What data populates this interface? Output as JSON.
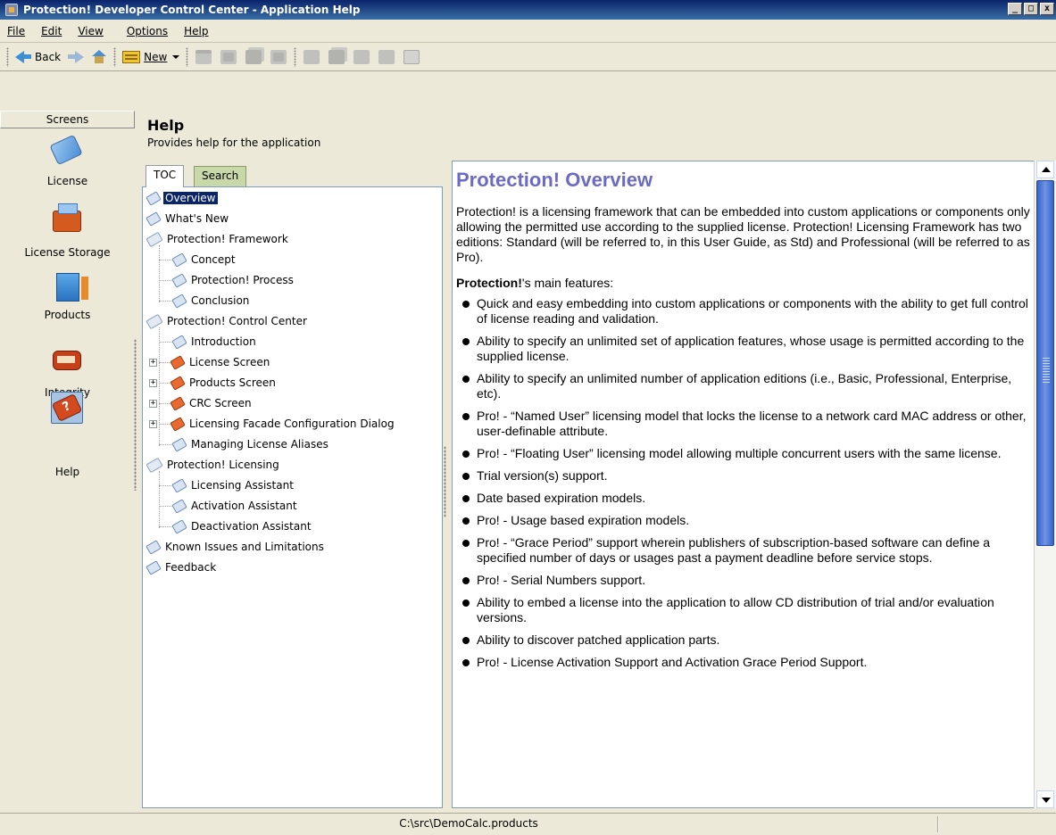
{
  "window": {
    "title": "Protection! Developer Control Center - Application Help",
    "buttons": {
      "minimize": "_",
      "maximize": "□",
      "close": "x"
    }
  },
  "menu": [
    {
      "label": "File",
      "underline": "F"
    },
    {
      "label": "Edit",
      "underline": "E"
    },
    {
      "label": "View",
      "underline": "V"
    },
    {
      "label": "Options",
      "underline": "O"
    },
    {
      "label": "Help",
      "underline": "H"
    }
  ],
  "toolbar": {
    "back_label": "Back",
    "new_label": "New",
    "icons": [
      "back-arrow-icon",
      "forward-arrow-icon",
      "home-icon",
      "new-icon",
      "open-folder-icon",
      "save-icon",
      "save-all-icon",
      "save-as-icon",
      "edit-icon",
      "copy-icon",
      "paste-icon",
      "settings-icon",
      "delete-icon"
    ]
  },
  "sidebar": {
    "header": "Screens",
    "items": [
      {
        "label": "License",
        "icon": "license-icon"
      },
      {
        "label": "License Storage",
        "icon": "license-storage-icon"
      },
      {
        "label": "Products",
        "icon": "products-icon"
      },
      {
        "label": "Integrity",
        "icon": "integrity-icon"
      },
      {
        "label": "Help",
        "icon": "help-icon",
        "selected": true
      }
    ]
  },
  "help": {
    "title": "Help",
    "subtitle": "Provides help for the application",
    "tabs": [
      {
        "label": "TOC",
        "active": true
      },
      {
        "label": "Search",
        "active": false
      }
    ]
  },
  "toc": [
    {
      "label": "Overview",
      "level": 0,
      "icon": "page",
      "selected": true
    },
    {
      "label": "What's New",
      "level": 0,
      "icon": "page"
    },
    {
      "label": "Protection! Framework",
      "level": 0,
      "icon": "book"
    },
    {
      "label": "Concept",
      "level": 1,
      "icon": "page"
    },
    {
      "label": "Protection! Process",
      "level": 1,
      "icon": "page"
    },
    {
      "label": "Conclusion",
      "level": 1,
      "icon": "page"
    },
    {
      "label": "Protection! Control Center",
      "level": 0,
      "icon": "book"
    },
    {
      "label": "Introduction",
      "level": 1,
      "icon": "page"
    },
    {
      "label": "License Screen",
      "level": 1,
      "icon": "orange",
      "expander": "+"
    },
    {
      "label": "Products Screen",
      "level": 1,
      "icon": "orange",
      "expander": "+"
    },
    {
      "label": "CRC Screen",
      "level": 1,
      "icon": "orange",
      "expander": "+"
    },
    {
      "label": "Licensing Facade Configuration Dialog",
      "level": 1,
      "icon": "orange",
      "expander": "+"
    },
    {
      "label": "Managing License Aliases",
      "level": 1,
      "icon": "page"
    },
    {
      "label": "Protection! Licensing",
      "level": 0,
      "icon": "book"
    },
    {
      "label": "Licensing Assistant",
      "level": 1,
      "icon": "page"
    },
    {
      "label": "Activation Assistant",
      "level": 1,
      "icon": "page"
    },
    {
      "label": "Deactivation Assistant",
      "level": 1,
      "icon": "page"
    },
    {
      "label": "Known Issues and Limitations",
      "level": 0,
      "icon": "page"
    },
    {
      "label": "Feedback",
      "level": 0,
      "icon": "page"
    }
  ],
  "content": {
    "heading": "Protection! Overview",
    "intro": "Protection! is a licensing framework that can be embedded into custom applications or components only allowing the permitted use according to the supplied license. Protection! Licensing Framework has two editions: Standard (will be referred to, in this User Guide, as Std) and Professional (will be referred to as Pro).",
    "features_bold": "Protection!",
    "features_rest": "'s main features:",
    "features": [
      "Quick and easy embedding into custom applications or components with the ability to get full control of license reading and validation.",
      "Ability to specify an unlimited set of application features, whose usage is permitted according to the supplied license.",
      "Ability to specify an unlimited number of application editions (i.e., Basic, Professional, Enterprise, etc).",
      "Pro! - “Named User” licensing model that locks the license to a network card MAC address or other, user-definable attribute.",
      "Pro! - “Floating User” licensing model allowing multiple concurrent users with the same license.",
      "Trial version(s) support.",
      "Date based expiration models.",
      "Pro! - Usage based expiration models.",
      "Pro! - “Grace Period” support wherein publishers of subscription-based software can define a specified number of days or usages past a payment deadline before service stops.",
      "Pro! - Serial Numbers support.",
      "Ability to embed a license into the application to allow CD distribution of trial and/or evaluation versions.",
      "Ability to discover patched application parts.",
      "Pro! - License Activation Support and Activation Grace Period Support."
    ]
  },
  "status": {
    "path": "C:\\src\\DemoCalc.products"
  }
}
